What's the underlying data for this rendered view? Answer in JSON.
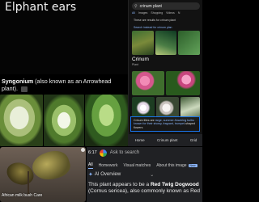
{
  "top_left": {
    "title_line1": "Elphant ears"
  },
  "phone": {
    "search_query": "crinum plant",
    "tabs": [
      "All",
      "Images",
      "Shopping",
      "Videos",
      "N"
    ],
    "note": "These are results for crinum plant",
    "note_link": "Search instead for crinum plan",
    "knowledge_panel": {
      "title": "Crinum",
      "subtitle": "Plant"
    },
    "caption_prefix": "Crinum lilies are ",
    "caption_highlight": "large, summer-flowering bulbs known for their showy, fragrant, trumpet",
    "caption_suffix": "-shaped flowers",
    "bottom_nav": [
      "Home",
      "Crinum plant",
      "Grid"
    ]
  },
  "syngonium": {
    "bold": "Syngonium",
    "rest": " (also known as an Arrowhead plant)."
  },
  "pot": {
    "label": "African milk bush Care"
  },
  "lens": {
    "time": "6:17",
    "ask": "Ask to search",
    "tabs": [
      {
        "label": "All",
        "active": true
      },
      {
        "label": "Homework",
        "active": false
      },
      {
        "label": "Visual matches",
        "active": false
      },
      {
        "label": "About this image",
        "active": false,
        "badge": "New"
      }
    ],
    "overview_label": "AI Overview",
    "answer_prefix": "This plant appears to be a ",
    "answer_bold": "Red Twig Dogwood",
    "answer_suffix": " (Cornus sericea), also commonly known as Red"
  }
}
